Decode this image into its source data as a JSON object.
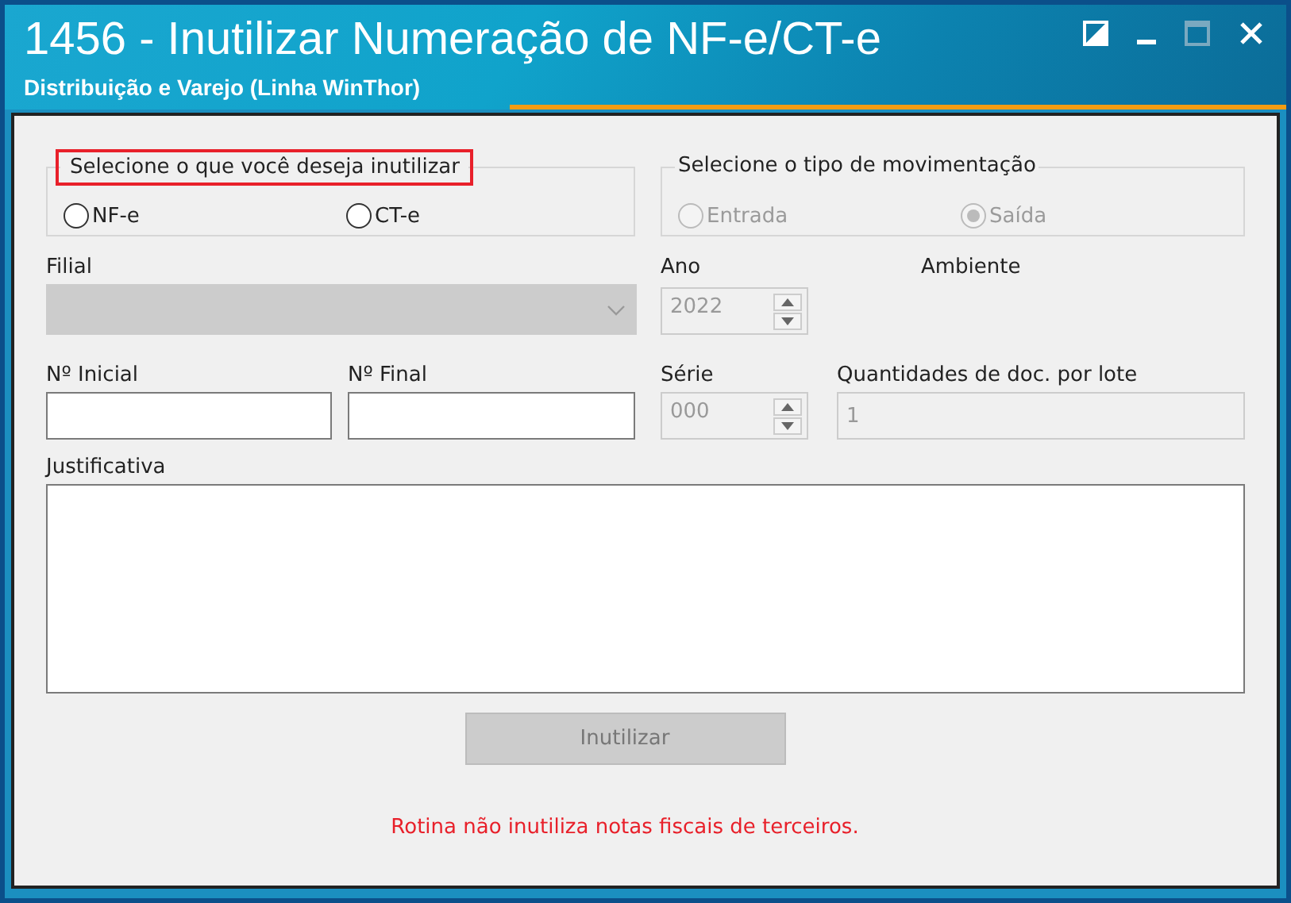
{
  "window": {
    "title": "1456 - Inutilizar Numeração de NF-e/CT-e",
    "subtitle": "Distribuição e Varejo (Linha WinThor)"
  },
  "document_group": {
    "legend": "Selecione o que você deseja inutilizar",
    "highlighted": true,
    "options": [
      {
        "label": "NF-e",
        "selected": false,
        "disabled": false
      },
      {
        "label": "CT-e",
        "selected": false,
        "disabled": false
      }
    ]
  },
  "movement_group": {
    "legend": "Selecione o tipo de movimentação",
    "highlighted": false,
    "options": [
      {
        "label": "Entrada",
        "selected": false,
        "disabled": true
      },
      {
        "label": "Saída",
        "selected": true,
        "disabled": true
      }
    ]
  },
  "filial": {
    "label": "Filial",
    "disabled": true
  },
  "ano": {
    "label": "Ano",
    "value": "2022",
    "disabled": true
  },
  "ambiente": {
    "label": "Ambiente"
  },
  "numero_inicial": {
    "label": "Nº Inicial",
    "disabled": false
  },
  "numero_final": {
    "label": "Nº Final",
    "disabled": false
  },
  "serie": {
    "label": "Série",
    "value": "000",
    "disabled": true
  },
  "quantidade": {
    "label": "Quantidades de doc. por lote",
    "value": "1",
    "disabled": true
  },
  "justificativa": {
    "label": "Justificativa"
  },
  "button": {
    "label": "Inutilizar",
    "disabled": true
  },
  "note": "Rotina não inutiliza notas fiscais de terceiros."
}
